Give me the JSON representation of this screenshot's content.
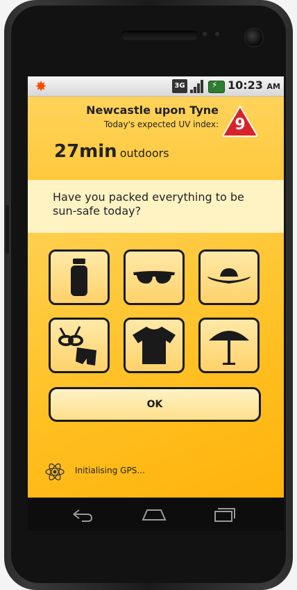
{
  "status_bar": {
    "network_label": "3G",
    "time": "10:23",
    "ampm": "AM",
    "app_icon": "sun-icon"
  },
  "header": {
    "city": "Newcastle upon Tyne",
    "uv_label": "Today's expected UV index:",
    "uv_index": "9",
    "minutes_value": "27min",
    "minutes_unit": "outdoors"
  },
  "question": "Have you packed everything to be sun-safe today?",
  "items": [
    {
      "name": "sunscreen",
      "icon": "sunscreen-bottle-icon"
    },
    {
      "name": "sunglasses",
      "icon": "sunglasses-icon"
    },
    {
      "name": "hat",
      "icon": "sun-hat-icon"
    },
    {
      "name": "swimwear",
      "icon": "swimwear-icon"
    },
    {
      "name": "t-shirt",
      "icon": "t-shirt-icon"
    },
    {
      "name": "umbrella",
      "icon": "parasol-icon"
    }
  ],
  "ok_label": "OK",
  "gps_status": "Initialising GPS...",
  "colors": {
    "accent": "#ffc93d",
    "uv_badge": "#d8232a",
    "question_band": "#fff3c4"
  }
}
